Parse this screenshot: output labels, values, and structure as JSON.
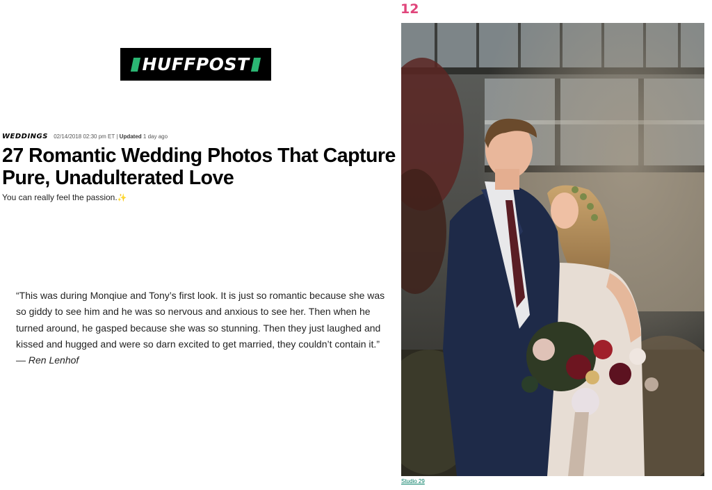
{
  "logo": {
    "text": "HUFFPOST"
  },
  "article": {
    "section": "WEDDINGS",
    "timestamp": "02/14/2018 02:30 pm ET",
    "separator": "|",
    "updated_label": "Updated",
    "updated_value": "1 day ago",
    "title": "27 Romantic Wedding Photos That Capture Pure, Unadulterated Love",
    "subtitle": "You can really feel the passion.",
    "subtitle_emoji": "✨"
  },
  "slide": {
    "number": "12",
    "quote": "“This was during Monqiue and Tony’s first look. It is just so romantic because she was so giddy to see him and he was so nervous and anxious to see her. Then when he turned around, he gasped because she was so stunning. Then they just laughed and kissed and hugged and were so darn excited to get married, they couldn’t contain it.”",
    "quote_author": "— Ren Lenhof",
    "photo_credit": "Studio 29"
  },
  "colors": {
    "brand_green": "#2bb673",
    "slide_number_pink": "#e0457b",
    "credit_link": "#007c63"
  }
}
